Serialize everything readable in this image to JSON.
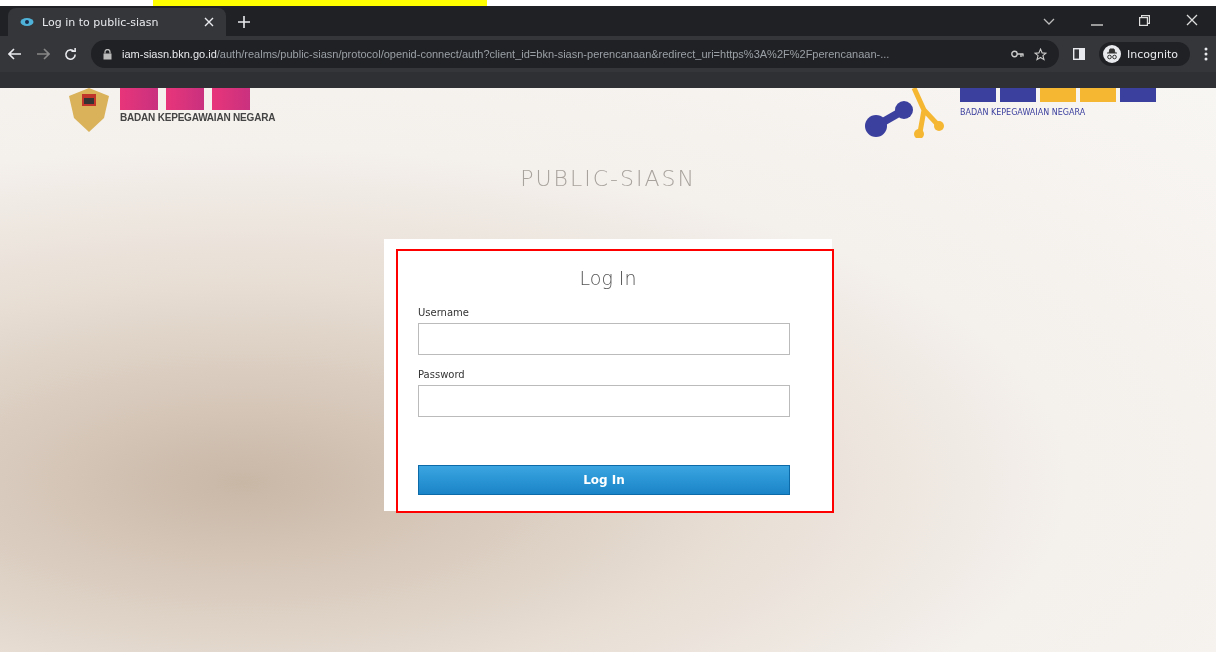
{
  "browser": {
    "tab": {
      "title": "Log in to public-siasn",
      "selected": true
    },
    "url": {
      "host": "iam-siasn.bkn.go.id",
      "path": "/auth/realms/public-siasn/protocol/openid-connect/auth?client_id=bkn-siasn-perencanaan&redirect_uri=https%3A%2F%2Fperencanaan-..."
    },
    "profile": "Incognito"
  },
  "page": {
    "left_logo": {
      "caption": "BADAN KEPEGAWAIAN NEGARA"
    },
    "right_logo": {
      "caption": "BADAN KEPEGAWAIAN NEGARA"
    },
    "realm_title": "PUBLIC-SIASN",
    "form": {
      "title": "Log In",
      "fields": [
        {
          "label": "Username"
        },
        {
          "label": "Password"
        }
      ],
      "submit": "Log In"
    }
  }
}
